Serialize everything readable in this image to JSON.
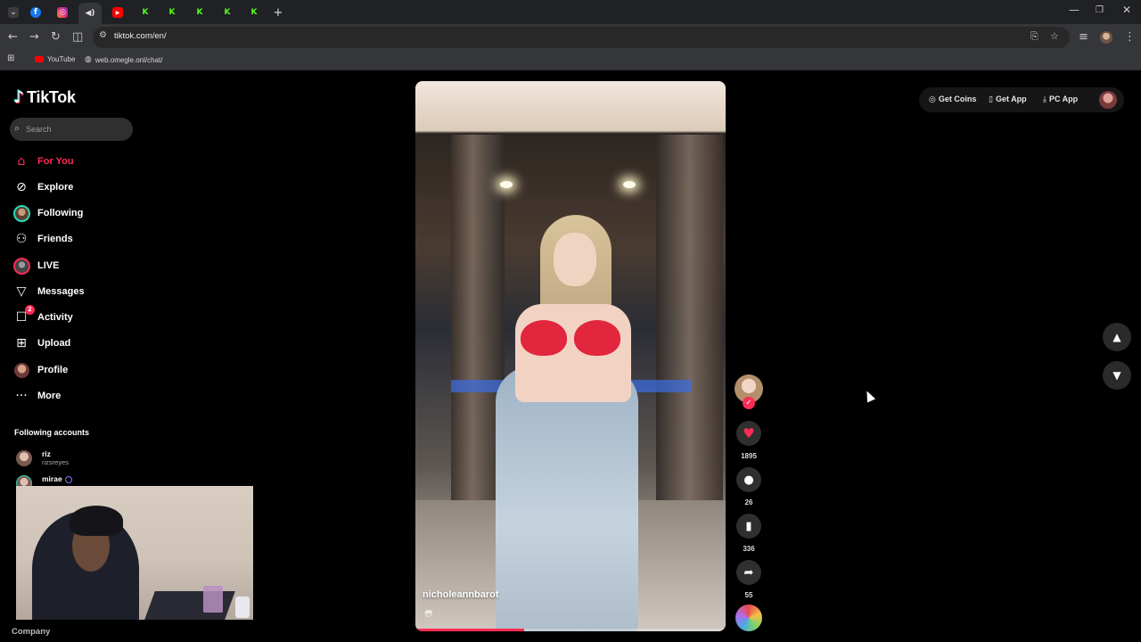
{
  "browser": {
    "tabs": [
      {
        "icon": "chevron-down-icon",
        "color": "#3c3c3c"
      },
      {
        "icon": "facebook-icon",
        "color": "#1877f2",
        "glyph": "f"
      },
      {
        "icon": "instagram-icon",
        "color": "#e1306c",
        "glyph": "◎"
      },
      {
        "icon": "speaker-icon",
        "color": "#35363a",
        "glyph": "🔈"
      },
      {
        "icon": "youtube-icon",
        "color": "#ff0000",
        "glyph": "▶"
      },
      {
        "icon": "kick-icon",
        "color": "#53fc18",
        "glyph": "K"
      },
      {
        "icon": "kick-icon",
        "color": "#53fc18",
        "glyph": "K"
      },
      {
        "icon": "kick-icon",
        "color": "#53fc18",
        "glyph": "K"
      },
      {
        "icon": "kick-icon",
        "color": "#53fc18",
        "glyph": "K"
      },
      {
        "icon": "kick-icon",
        "color": "#53fc18",
        "glyph": "K"
      }
    ],
    "new_tab": "+",
    "url": "tiktok.com/en/",
    "bookmarks": [
      {
        "label": "YouTube",
        "icon": "youtube-icon"
      },
      {
        "label": "web.omegle.onl/chat/",
        "icon": "globe-icon"
      }
    ]
  },
  "tiktok": {
    "logo": "TikTok",
    "search_placeholder": "Search",
    "nav": [
      {
        "label": "For You",
        "icon": "home-icon",
        "active": true
      },
      {
        "label": "Explore",
        "icon": "compass-icon"
      },
      {
        "label": "Following",
        "icon": "following-avatar"
      },
      {
        "label": "Friends",
        "icon": "friends-icon"
      },
      {
        "label": "LIVE",
        "icon": "live-avatar"
      },
      {
        "label": "Messages",
        "icon": "send-icon"
      },
      {
        "label": "Activity",
        "icon": "activity-icon",
        "badge": "2"
      },
      {
        "label": "Upload",
        "icon": "upload-icon"
      },
      {
        "label": "Profile",
        "icon": "profile-avatar"
      },
      {
        "label": "More",
        "icon": "more-icon"
      }
    ],
    "following_title": "Following accounts",
    "accounts": [
      {
        "name": "riz",
        "handle": "rizsreyes"
      },
      {
        "name": "mirae",
        "handle": "",
        "verified": true
      }
    ],
    "footer": "Company",
    "video": {
      "creator": "nicholeannbarot",
      "caption_emoji": "😳",
      "progress": 0.35
    },
    "actions": {
      "likes": "1895",
      "comments": "26",
      "saves": "336",
      "shares": "55"
    },
    "topbar": {
      "get_coins": "Get Coins",
      "get_app": "Get App",
      "pc_app": "PC App"
    },
    "accent": "#fe2c55"
  }
}
